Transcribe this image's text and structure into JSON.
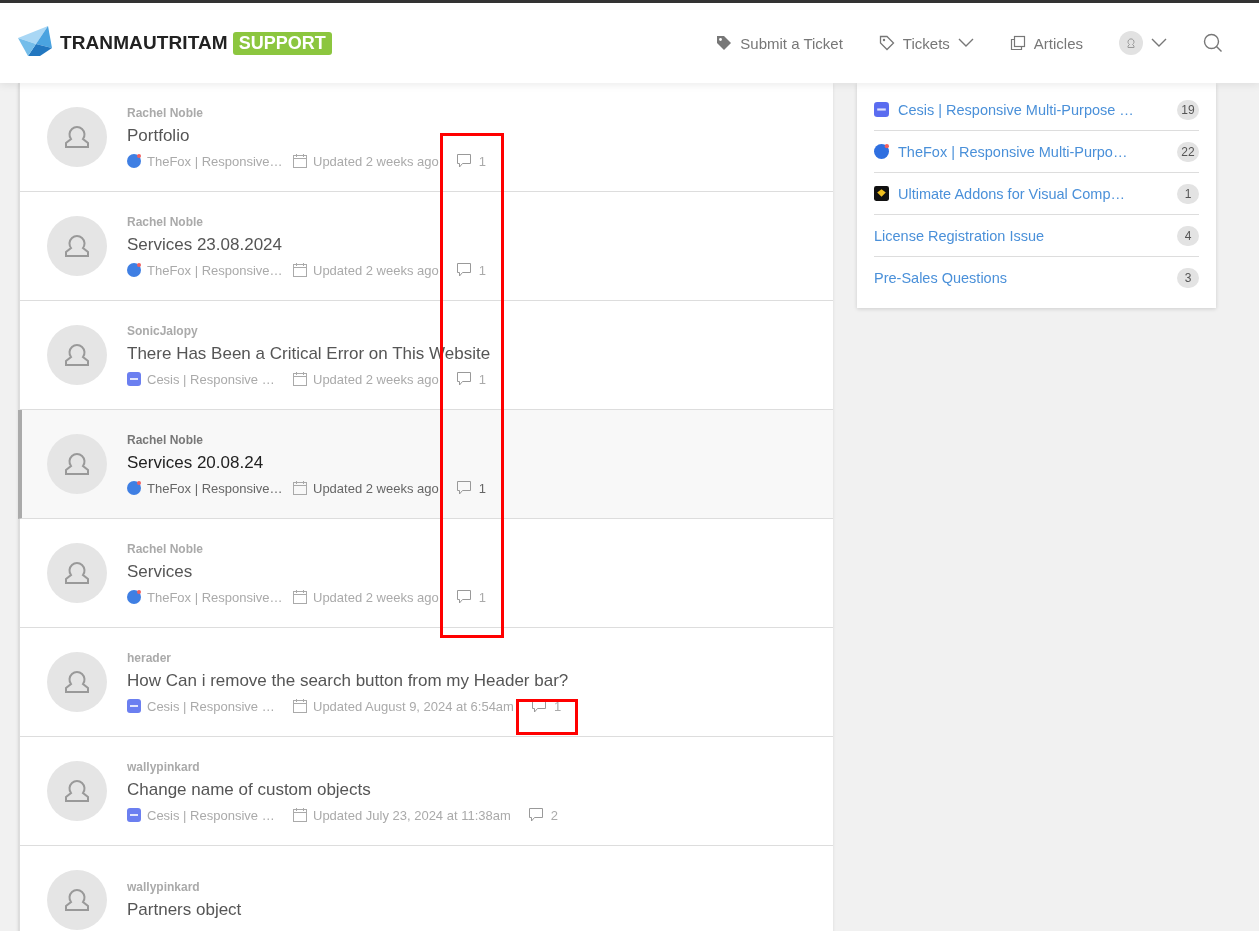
{
  "header": {
    "logo": {
      "name": "TRANMAUTRITAM",
      "badge": "SUPPORT"
    },
    "nav": [
      {
        "kind": "submit",
        "label": "Submit a Ticket"
      },
      {
        "kind": "tickets",
        "label": "Tickets"
      },
      {
        "kind": "articles",
        "label": "Articles"
      },
      {
        "kind": "account"
      },
      {
        "kind": "search"
      }
    ]
  },
  "tickets": [
    {
      "author": "Rachel Noble",
      "title": "Portfolio",
      "selected": false,
      "product": {
        "kind": "thefox",
        "name": "TheFox | Responsive…"
      },
      "updated": "Updated 2 weeks ago",
      "comments": "1"
    },
    {
      "author": "Rachel Noble",
      "title": "Services 23.08.2024",
      "selected": false,
      "product": {
        "kind": "thefox",
        "name": "TheFox | Responsive…"
      },
      "updated": "Updated 2 weeks ago",
      "comments": "1"
    },
    {
      "author": "SonicJalopy",
      "title": "There Has Been a Critical Error on This Website",
      "selected": false,
      "product": {
        "kind": "cesis",
        "name": "Cesis | Responsive …"
      },
      "updated": "Updated 2 weeks ago",
      "comments": "1"
    },
    {
      "author": "Rachel Noble",
      "title": "Services 20.08.24",
      "selected": true,
      "product": {
        "kind": "thefox",
        "name": "TheFox | Responsive…"
      },
      "updated": "Updated 2 weeks ago",
      "comments": "1"
    },
    {
      "author": "Rachel Noble",
      "title": "Services",
      "selected": false,
      "product": {
        "kind": "thefox",
        "name": "TheFox | Responsive…"
      },
      "updated": "Updated 2 weeks ago",
      "comments": "1"
    },
    {
      "author": "herader",
      "title": "How Can i remove the search button from my Header bar?",
      "selected": false,
      "product": {
        "kind": "cesis",
        "name": "Cesis | Responsive …"
      },
      "updated": "Updated August 9, 2024 at 6:54am",
      "comments": "1"
    },
    {
      "author": "wallypinkard",
      "title": "Change name of custom objects",
      "selected": false,
      "product": {
        "kind": "cesis",
        "name": "Cesis | Responsive …"
      },
      "updated": "Updated July 23, 2024 at 11:38am",
      "comments": "2"
    },
    {
      "author": "wallypinkard",
      "title": "Partners object",
      "selected": false
    }
  ],
  "categories": [
    {
      "kind": "cesis",
      "label": "Cesis | Responsive Multi-Purpose …",
      "count": "19"
    },
    {
      "kind": "thefox",
      "label": "TheFox | Responsive Multi-Purpo…",
      "count": "22"
    },
    {
      "kind": "ultimate",
      "label": "Ultimate Addons for Visual Comp…",
      "count": "1"
    },
    {
      "kind": "plain",
      "label": "License Registration Issue",
      "count": "4"
    },
    {
      "kind": "plain",
      "label": "Pre-Sales Questions",
      "count": "3"
    }
  ],
  "annotations": [
    {
      "kind": "box"
    },
    {
      "kind": "box"
    }
  ]
}
